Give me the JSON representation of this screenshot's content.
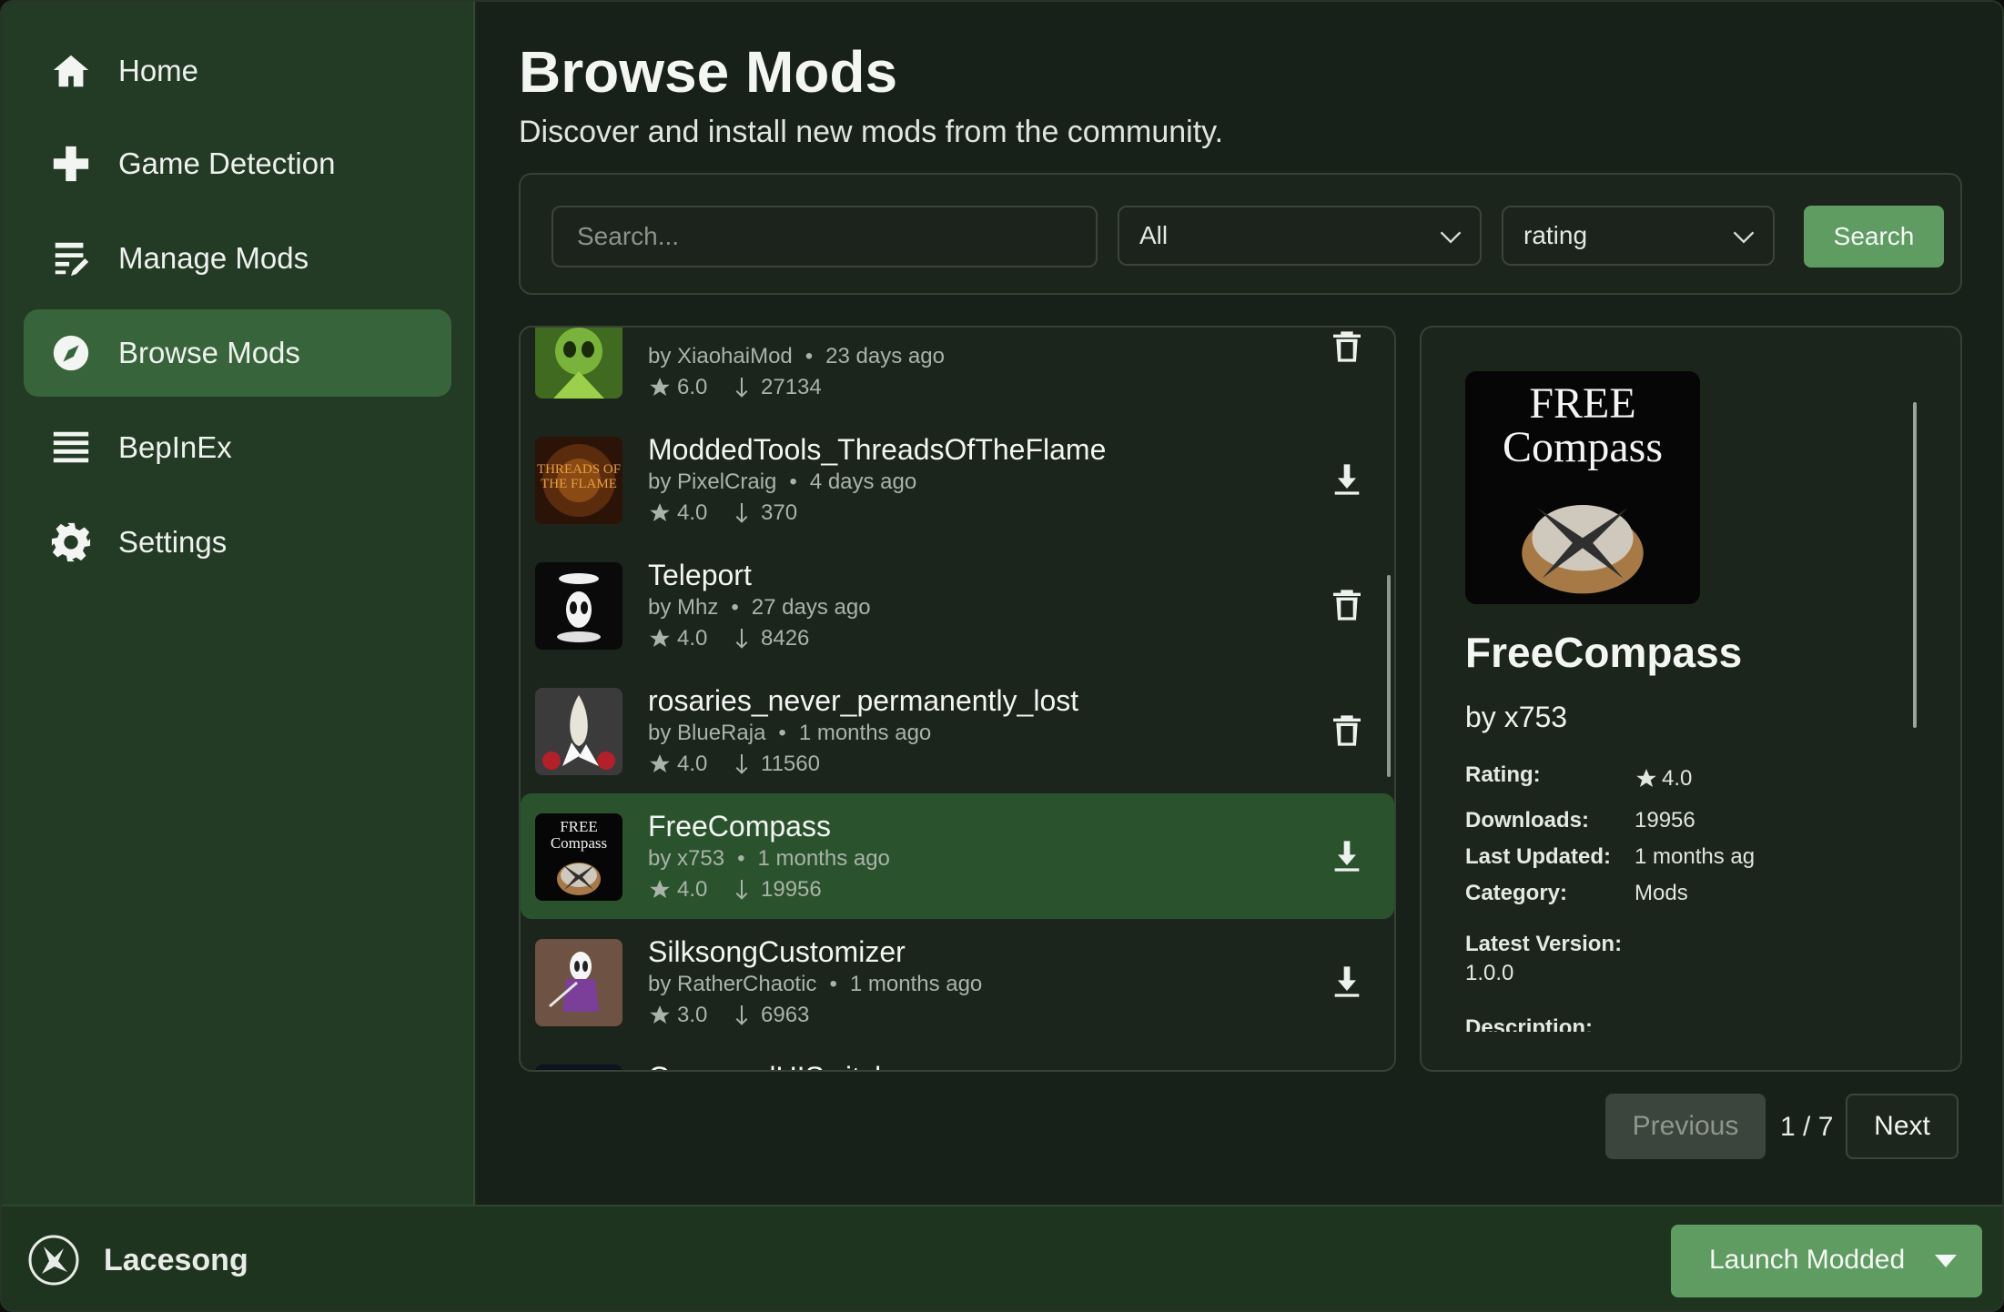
{
  "sidebar": {
    "items": [
      {
        "label": "Home",
        "icon": "home-icon"
      },
      {
        "label": "Game Detection",
        "icon": "plus-icon"
      },
      {
        "label": "Manage Mods",
        "icon": "edit-list-icon"
      },
      {
        "label": "Browse Mods",
        "icon": "compass-icon",
        "active": true
      },
      {
        "label": "BepInEx",
        "icon": "list-icon"
      },
      {
        "label": "Settings",
        "icon": "gear-icon"
      }
    ]
  },
  "header": {
    "title": "Browse Mods",
    "subtitle": "Discover and install new mods from the community."
  },
  "filters": {
    "search_placeholder": "Search...",
    "category_value": "All",
    "sort_value": "rating",
    "search_button": "Search"
  },
  "mods": [
    {
      "name": "",
      "author": "by XiaohaiMod",
      "updated": "23 days ago",
      "rating": "6.0",
      "downloads": "27134",
      "action": "delete"
    },
    {
      "name": "ModdedTools_ThreadsOfTheFlame",
      "author": "by PixelCraig",
      "updated": "4 days ago",
      "rating": "4.0",
      "downloads": "370",
      "action": "download",
      "thumb_text": "THREADS OF THE FLAME"
    },
    {
      "name": "Teleport",
      "author": "by Mhz",
      "updated": "27 days ago",
      "rating": "4.0",
      "downloads": "8426",
      "action": "delete"
    },
    {
      "name": "rosaries_never_permanently_lost",
      "author": "by BlueRaja",
      "updated": "1 months ago",
      "rating": "4.0",
      "downloads": "11560",
      "action": "delete"
    },
    {
      "name": "FreeCompass",
      "author": "by x753",
      "updated": "1 months ago",
      "rating": "4.0",
      "downloads": "19956",
      "action": "download",
      "active": true,
      "thumb_text_1": "FREE",
      "thumb_text_2": "Compass"
    },
    {
      "name": "SilksongCustomizer",
      "author": "by RatherChaotic",
      "updated": "1 months ago",
      "rating": "3.0",
      "downloads": "6963",
      "action": "download"
    },
    {
      "name": "GamepadUISwitcher",
      "author": "",
      "updated": "",
      "rating": "",
      "downloads": "",
      "action": ""
    }
  ],
  "detail": {
    "thumb_text_1": "FREE",
    "thumb_text_2": "Compass",
    "title": "FreeCompass",
    "author": "by x753",
    "rating_label": "Rating:",
    "rating_value": "4.0",
    "downloads_label": "Downloads:",
    "downloads_value": "19956",
    "updated_label": "Last Updated:",
    "updated_value": "1 months ag",
    "category_label": "Category:",
    "category_value": "Mods",
    "version_label": "Latest Version:",
    "version_value": "1.0.0",
    "description_label": "Description:"
  },
  "pagination": {
    "previous": "Previous",
    "count": "1 / 7",
    "next": "Next"
  },
  "footer": {
    "brand": "Lacesong",
    "launch_label": "Launch Modded"
  },
  "colors": {
    "accent": "#5f9c62",
    "sidebar_bg": "#233a25",
    "active_nav": "#38643b",
    "active_row": "#2a532d"
  }
}
